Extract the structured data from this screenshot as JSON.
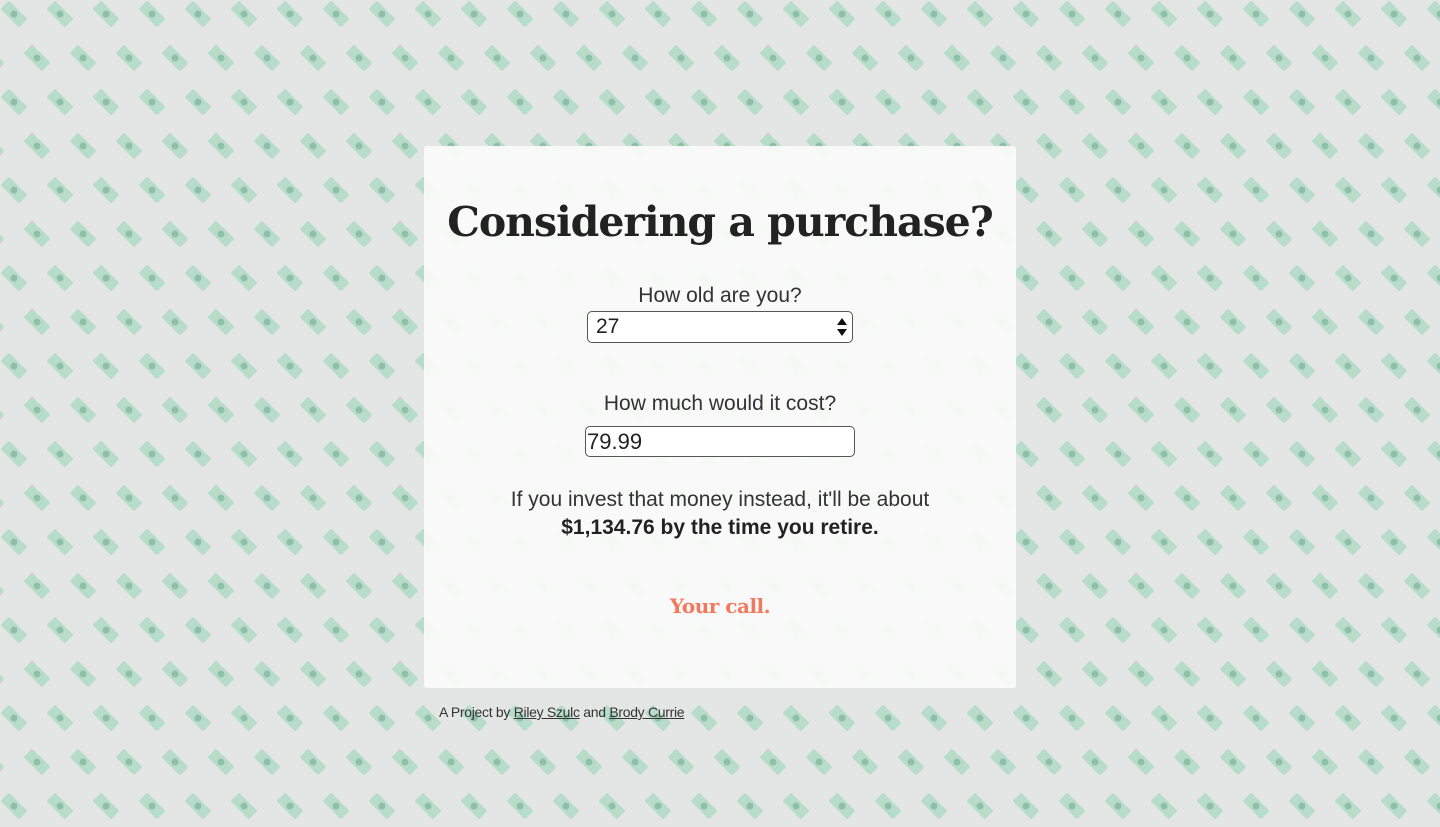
{
  "colors": {
    "page_background": "#e4e6e5",
    "card_background": "#fafafa",
    "accent": "#f17a5e",
    "pattern_bill": "#b7dcc9",
    "pattern_bill_dark": "#8fbfa7"
  },
  "background": {
    "pattern_icon": "dollar-bill-icon"
  },
  "card": {
    "title": "Considering a purchase?",
    "age": {
      "label": "How old are you?",
      "selected_value": "27",
      "icon": "select-arrows-icon"
    },
    "cost": {
      "label": "How much would it cost?",
      "value": "79.99"
    },
    "result": {
      "line1": "If you invest that money instead, it'll be about",
      "line2": "$1,134.76 by the time you retire."
    },
    "call_to_action": "Your call."
  },
  "footer": {
    "prefix": "A Project by",
    "author1": "Riley Szulc",
    "conjunction": "and",
    "author2": "Brody Currie"
  }
}
